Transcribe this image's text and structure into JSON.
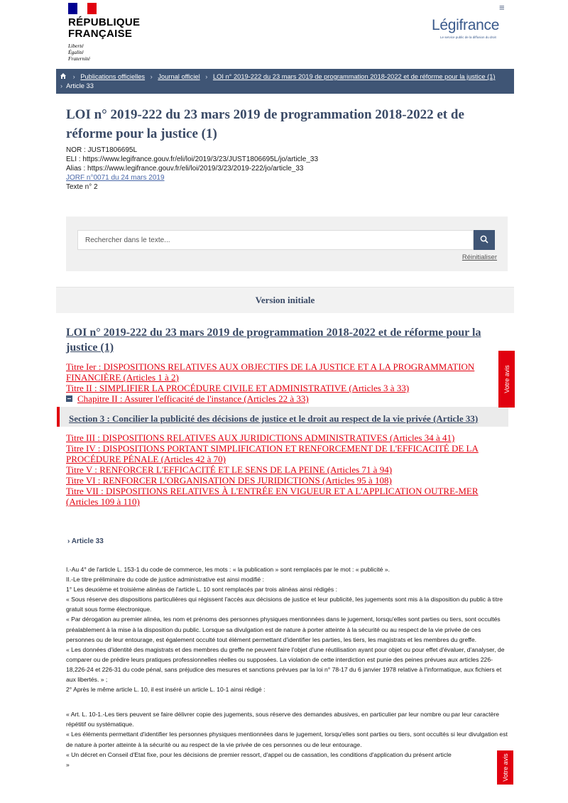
{
  "header": {
    "republic_line1": "RÉPUBLIQUE",
    "republic_line2": "FRANÇAISE",
    "motto": [
      "Liberté",
      "Égalité",
      "Fraternité"
    ],
    "brand": "Légifrance",
    "brand_subtitle": "Le service public de la diffusion du droit",
    "menu_icon": "hamburger-menu-icon"
  },
  "breadcrumb": {
    "items": [
      "Publications officielles",
      "Journal officiel",
      "LOI n° 2019-222 du 23 mars 2019 de programmation 2018-2022 et de réforme pour la justice (1)",
      "Article 33"
    ]
  },
  "law": {
    "title": "LOI n° 2019-222 du 23 mars 2019 de programmation 2018-2022 et de réforme pour la justice (1)",
    "nor": "NOR : JUST1806695L",
    "eli": "ELI : https://www.legifrance.gouv.fr/eli/loi/2019/3/23/JUST1806695L/jo/article_33",
    "alias": "Alias : https://www.legifrance.gouv.fr/eli/loi/2019/3/23/2019-222/jo/article_33",
    "jorf": "JORF n°0071 du 24 mars 2019",
    "texte": "Texte n° 2"
  },
  "search": {
    "placeholder": "Rechercher dans le texte...",
    "reset_label": "Réinitialiser"
  },
  "version_label": "Version initiale",
  "toc": {
    "title": "LOI n° 2019-222 du 23 mars 2019 de programmation 2018-2022 et de réforme pour la justice (1)",
    "titre1": "Titre Ier : DISPOSITIONS RELATIVES AUX OBJECTIFS DE LA JUSTICE ET A LA PROGRAMMATION FINANCIÈRE (Articles 1 à 2)",
    "titre2": "Titre II : SIMPLIFIER LA PROCÉDURE CIVILE ET ADMINISTRATIVE (Articles 3 à 33)",
    "chapitre2": "Chapitre II : Assurer l'efficacité de l'instance (Articles 22 à 33)",
    "section3": "Section 3 : Concilier la publicité des décisions de justice et le droit au respect de la vie privée (Article 33)",
    "titre3": "Titre III : DISPOSITIONS RELATIVES AUX JURIDICTIONS ADMINISTRATIVES (Articles 34 à 41)",
    "titre4": "Titre IV : DISPOSITIONS PORTANT SIMPLIFICATION ET RENFORCEMENT DE L'EFFICACITÉ DE LA PROCÉDURE PÉNALE (Articles 42 à 70)",
    "titre5": "Titre V : RENFORCER L'EFFICACITÉ ET LE SENS DE LA PEINE (Articles 71 à 94)",
    "titre6": "Titre VI : RENFORCER L'ORGANISATION DES JURIDICTIONS (Articles 95 à 108)",
    "titre7": "Titre VII : DISPOSITIONS RELATIVES À L'ENTRÉE EN VIGUEUR ET A L'APPLICATION OUTRE-MER (Articles 109 à 110)"
  },
  "article": {
    "label": "Article 33",
    "paragraphs": [
      "I.-Au 4° de l'article L. 153-1 du code de commerce, les mots : « la publication » sont remplacés par le mot : « publicité ».",
      "II.-Le titre préliminaire du code de justice administrative est ainsi modifié :",
      "1° Les deuxième et troisième alinéas de l'article L. 10 sont remplacés par trois alinéas ainsi rédigés :",
      "« Sous réserve des dispositions particulières qui régissent l'accès aux décisions de justice et leur publicité, les jugements sont mis à la disposition du public à titre gratuit sous forme électronique.",
      "« Par dérogation au premier alinéa, les nom et prénoms des personnes physiques mentionnées dans le jugement, lorsqu'elles sont parties ou tiers, sont occultés préalablement à la mise à la disposition du public. Lorsque sa divulgation est de nature à porter atteinte à la sécurité ou au respect de la vie privée de ces personnes ou de leur entourage, est également occulté tout élément permettant d'identifier les parties, les tiers, les magistrats et les membres du greffe.",
      "« Les données d'identité des magistrats et des membres du greffe ne peuvent faire l'objet d'une réutilisation ayant pour objet ou pour effet d'évaluer, d'analyser, de comparer ou de prédire leurs pratiques professionnelles réelles ou supposées. La violation de cette interdiction est punie des peines prévues aux articles 226-18,226-24 et 226-31 du code pénal, sans préjudice des mesures et sanctions prévues par la loi n° 78-17 du 6 janvier 1978 relative à l'informatique, aux fichiers et aux libertés. » ;",
      "2° Après le même article L. 10, il est inséré un article L. 10-1 ainsi rédigé :",
      "« Art. L. 10-1.-Les tiers peuvent se faire délivrer copie des jugements, sous réserve des demandes abusives, en particulier par leur nombre ou par leur caractère répétitif ou systématique.",
      "« Les éléments permettant d'identifier les personnes physiques mentionnées dans le jugement, lorsqu'elles sont parties ou tiers, sont occultés si leur divulgation est de nature à porter atteinte à la sécurité ou au respect de la vie privée de ces personnes ou de leur entourage.",
      "« Un décret en Conseil d'Etat fixe, pour les décisions de premier ressort, d'appel ou de cassation, les conditions d'application du présent article",
      "»"
    ]
  },
  "feedback_tab": "Votre avis",
  "colors": {
    "navy": "#3f5575",
    "red": "#e1000f",
    "brand_blue": "#3a5a8c"
  }
}
